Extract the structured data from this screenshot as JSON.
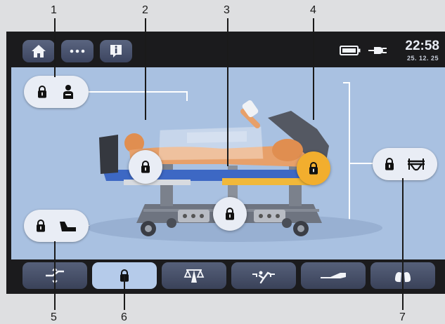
{
  "callouts": [
    "1",
    "2",
    "3",
    "4",
    "5",
    "6",
    "7"
  ],
  "status": {
    "time": "22:58",
    "date": "25. 12. 25",
    "battery_icon": "battery-icon",
    "power_icon": "power-plug-icon"
  },
  "top_buttons": [
    "home-icon",
    "more-icon",
    "info-icon"
  ],
  "locks": {
    "patient": {
      "state": "locked",
      "icon": "patient-icon"
    },
    "backrest": {
      "state": "locked"
    },
    "lifting": {
      "state": "locked"
    },
    "legrest": {
      "state": "locked",
      "selected": true
    },
    "pedals": {
      "state": "locked",
      "icon": "foot-pedal-icon"
    },
    "bed_frame": {
      "state": "locked",
      "icon": "bed-frame-icon"
    }
  },
  "tabs": [
    {
      "icon": "positioning-icon",
      "selected": false
    },
    {
      "icon": "lock-icon",
      "selected": true
    },
    {
      "icon": "scale-icon",
      "selected": false
    },
    {
      "icon": "exercise-icon",
      "selected": false
    },
    {
      "icon": "mattress-icon",
      "selected": false
    },
    {
      "icon": "lungs-icon",
      "selected": false
    }
  ],
  "colors": {
    "screen_bg": "#a9c1e1",
    "accent": "#f2ae2e",
    "bezel": "#1b1b1d",
    "button_bg": "#e9edf5"
  }
}
